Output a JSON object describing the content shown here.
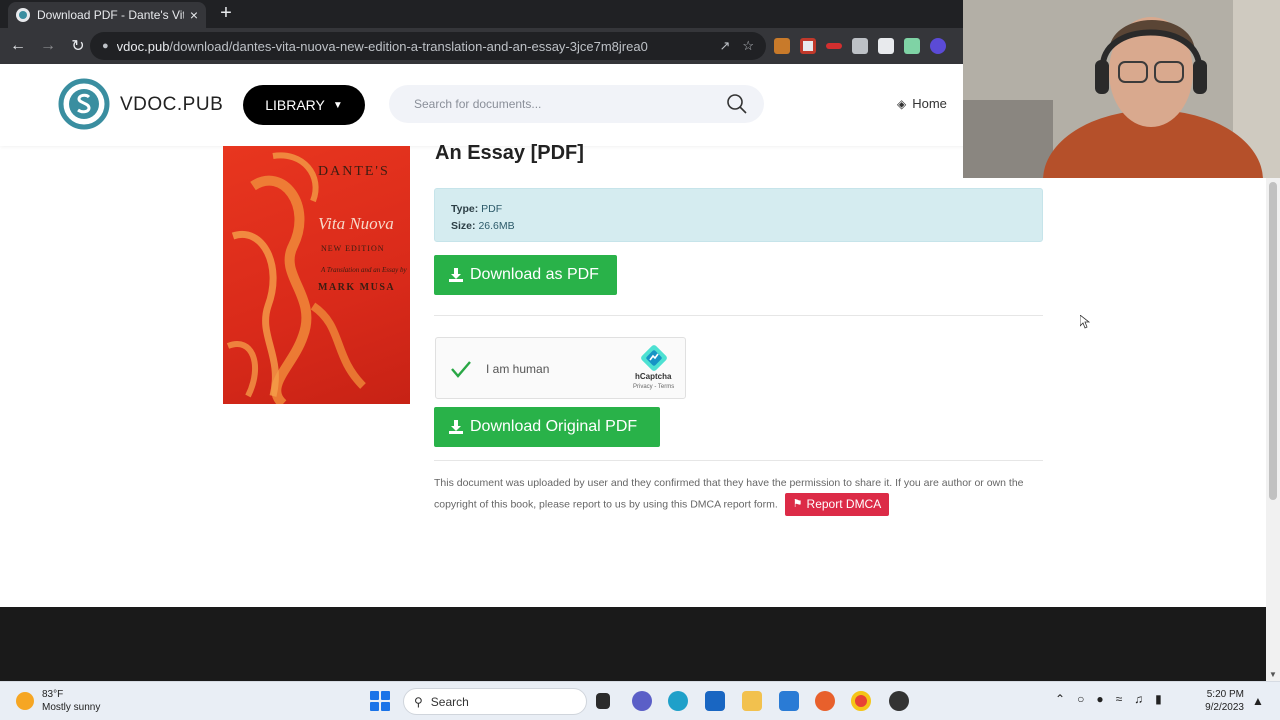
{
  "browser": {
    "tab_title": "Download PDF - Dante's Vita Nu",
    "tab_close": "×",
    "new_tab": "+",
    "url_host": "vdoc.pub",
    "url_path": "/download/dantes-vita-nuova-new-edition-a-translation-and-an-essay-3jce7m8jrea0"
  },
  "header": {
    "brand": "VDOC.PUB",
    "library_label": "LIBRARY",
    "search_placeholder": "Search for documents...",
    "home_label": "Home"
  },
  "book": {
    "cover_title": "DANTE'S",
    "cover_subtitle": "Vita Nuova",
    "cover_edition": "NEW EDITION",
    "cover_translation": "A Translation and an Essay by",
    "cover_author": "MARK MUSA"
  },
  "document": {
    "title": "An Essay [PDF]",
    "type_label": "Type:",
    "type_value": "PDF",
    "size_label": "Size:",
    "size_value": "26.6MB",
    "download_pdf_label": "Download as PDF",
    "download_original_label": "Download Original PDF",
    "notice": "This document was uploaded by user and they confirmed that they have the permission to share it. If you are author or own the copyright of this book, please report to us by using this DMCA report form.",
    "report_label": "Report DMCA"
  },
  "captcha": {
    "label": "I am human",
    "brand": "hCaptcha",
    "links": "Privacy - Terms"
  },
  "taskbar": {
    "temperature": "83°F",
    "weather": "Mostly sunny",
    "search_label": "Search",
    "time": "5:20 PM",
    "date": "9/2/2023"
  },
  "colors": {
    "green": "#29b249",
    "dmca_red": "#dc2b47",
    "info_bg": "#d5ecf0"
  }
}
